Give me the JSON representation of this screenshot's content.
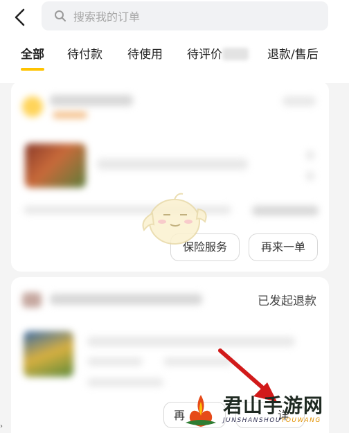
{
  "header": {
    "back_icon": "chevron-left-icon",
    "search": {
      "placeholder": "搜索我的订单",
      "icon": "search-icon"
    }
  },
  "tabs": [
    {
      "label": "全部",
      "active": true
    },
    {
      "label": "待付款",
      "active": false
    },
    {
      "label": "待使用",
      "active": false
    },
    {
      "label": "待评价",
      "active": false
    },
    {
      "label": "退款/售后",
      "active": false
    }
  ],
  "orders": [
    {
      "buttons": {
        "insurance": "保险服务",
        "reorder": "再来一单"
      }
    },
    {
      "status": "已发起退款",
      "buttons": {
        "reorder_partial": "再",
        "partial": "详"
      }
    }
  ],
  "watermark": {
    "title": "君山手游网",
    "subtitle_prefix": "JUNSHANSHOU",
    "subtitle_highlight": "YOUWANG"
  },
  "colors": {
    "accent": "#ffc300",
    "arrow": "#d11a1a"
  }
}
